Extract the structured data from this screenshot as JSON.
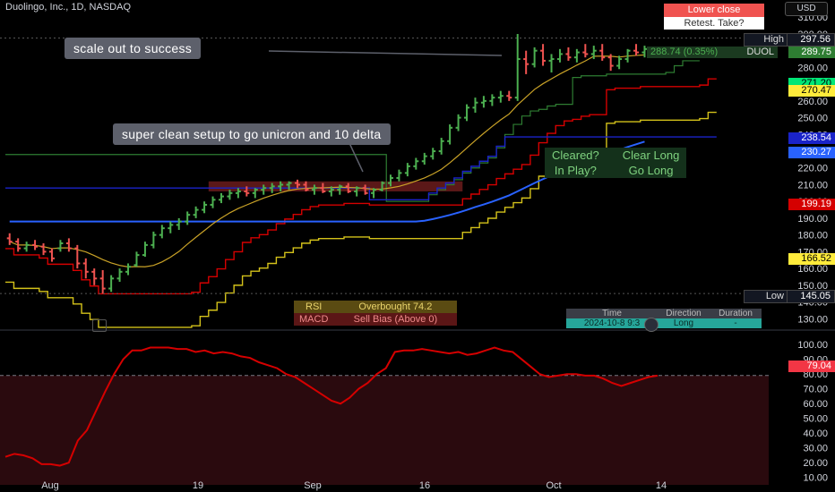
{
  "header": {
    "symbol_title": "Duolingo, Inc., 1D, NASDAQ",
    "currency": "USD"
  },
  "legend_boxes": {
    "lower_close": "Lower close",
    "retest": "Retest. Take?"
  },
  "callouts": {
    "top": "scale out to success",
    "middle": "super clean setup to go unicron and 10 delta"
  },
  "signal_table": {
    "rows": [
      [
        "Cleared?",
        "Clear Long"
      ],
      [
        "In Play?",
        "Go Long"
      ]
    ]
  },
  "indicator_table": {
    "rows": [
      [
        "RSI",
        "Overbought 74.2"
      ],
      [
        "MACD",
        "Sell Bias (Above 0)"
      ]
    ]
  },
  "trade_table": {
    "headers": [
      "Time",
      "Direction",
      "Duration"
    ],
    "row": [
      "2024-10-8 9:3",
      "Long",
      "-"
    ]
  },
  "price_tags": {
    "high_label": "High",
    "high_value": "297.56",
    "symbol": "DUOL",
    "last_value": "289.75",
    "last_change": "288.74 (0.35%)",
    "green_value": "271.20",
    "yellow_value": "270.47",
    "blue_dark_value": "238.54",
    "blue_value": "230.27",
    "red_value": "199.19",
    "yellow2_value": "166.52",
    "low_label": "Low",
    "low_value": "145.05",
    "rsi_value": "79.04"
  },
  "colors": {
    "up": "#4caf50",
    "down": "#f05350",
    "red_band": "#b22222",
    "yellow_band": "#d4c21a",
    "blue_band": "#2962ff",
    "blue_dark": "#1a23c9",
    "green_band": "#2e7d32",
    "tan_ma": "#c9a227"
  },
  "chart_data": [
    {
      "type": "candlestick",
      "title": "Duolingo, Inc., 1D, NASDAQ",
      "x_tick_labels": [
        "Aug",
        "19",
        "Sep",
        "16",
        "Oct",
        "14"
      ],
      "y_ticks": [
        130,
        140,
        150,
        160,
        170,
        180,
        190,
        200,
        210,
        220,
        230,
        240,
        250,
        260,
        270,
        280,
        290,
        300,
        310
      ],
      "ylim": [
        128,
        316
      ],
      "bars": [
        [
          178,
          181,
          174,
          176
        ],
        [
          176,
          178,
          170,
          172
        ],
        [
          172,
          176,
          170,
          174
        ],
        [
          174,
          177,
          171,
          173
        ],
        [
          173,
          175,
          168,
          170
        ],
        [
          170,
          172,
          164,
          166
        ],
        [
          172,
          177,
          170,
          175
        ],
        [
          175,
          178,
          170,
          172
        ],
        [
          172,
          174,
          160,
          163
        ],
        [
          163,
          166,
          154,
          158
        ],
        [
          158,
          160,
          150,
          154
        ],
        [
          154,
          159,
          145,
          148
        ],
        [
          148,
          156,
          146,
          154
        ],
        [
          154,
          160,
          152,
          158
        ],
        [
          158,
          163,
          156,
          161
        ],
        [
          162,
          170,
          161,
          168
        ],
        [
          168,
          176,
          167,
          174
        ],
        [
          174,
          182,
          172,
          180
        ],
        [
          180,
          186,
          178,
          184
        ],
        [
          184,
          188,
          181,
          186
        ],
        [
          186,
          190,
          183,
          188
        ],
        [
          188,
          194,
          186,
          192
        ],
        [
          192,
          197,
          190,
          195
        ],
        [
          195,
          200,
          193,
          198
        ],
        [
          198,
          203,
          196,
          201
        ],
        [
          201,
          205,
          199,
          203
        ],
        [
          203,
          207,
          201,
          205
        ],
        [
          205,
          208,
          202,
          206
        ],
        [
          206,
          209,
          203,
          205
        ],
        [
          205,
          208,
          202,
          207
        ],
        [
          207,
          210,
          204,
          208
        ],
        [
          208,
          211,
          205,
          209
        ],
        [
          209,
          212,
          206,
          210
        ],
        [
          210,
          212,
          207,
          211
        ],
        [
          211,
          213,
          208,
          210
        ],
        [
          210,
          212,
          206,
          207
        ],
        [
          207,
          210,
          204,
          208
        ],
        [
          208,
          211,
          205,
          206
        ],
        [
          206,
          209,
          203,
          207
        ],
        [
          207,
          210,
          204,
          209
        ],
        [
          209,
          211,
          205,
          206
        ],
        [
          206,
          209,
          203,
          208
        ],
        [
          208,
          210,
          204,
          205
        ],
        [
          205,
          208,
          202,
          207
        ],
        [
          207,
          212,
          206,
          211
        ],
        [
          211,
          216,
          209,
          214
        ],
        [
          214,
          219,
          212,
          217
        ],
        [
          217,
          223,
          215,
          221
        ],
        [
          221,
          226,
          219,
          224
        ],
        [
          224,
          229,
          222,
          227
        ],
        [
          227,
          232,
          225,
          230
        ],
        [
          230,
          238,
          228,
          236
        ],
        [
          236,
          246,
          234,
          244
        ],
        [
          244,
          252,
          242,
          250
        ],
        [
          250,
          258,
          248,
          256
        ],
        [
          256,
          262,
          253,
          259
        ],
        [
          259,
          263,
          256,
          260
        ],
        [
          260,
          264,
          257,
          262
        ],
        [
          262,
          266,
          259,
          263
        ],
        [
          263,
          266,
          260,
          262
        ],
        [
          262,
          300,
          260,
          285
        ],
        [
          285,
          290,
          276,
          282
        ],
        [
          282,
          292,
          280,
          290
        ],
        [
          290,
          294,
          281,
          284
        ],
        [
          284,
          288,
          277,
          285
        ],
        [
          285,
          291,
          283,
          288
        ],
        [
          288,
          292,
          284,
          286
        ],
        [
          286,
          291,
          283,
          289
        ],
        [
          289,
          294,
          286,
          288
        ],
        [
          288,
          293,
          285,
          290
        ],
        [
          290,
          294,
          284,
          286
        ],
        [
          286,
          288,
          278,
          281
        ],
        [
          281,
          287,
          279,
          285
        ],
        [
          285,
          291,
          283,
          290
        ],
        [
          290,
          294,
          287,
          289
        ],
        [
          289,
          293,
          286,
          291
        ]
      ]
    },
    {
      "type": "line",
      "title": "RSI",
      "y_ticks": [
        10,
        20,
        30,
        40,
        50,
        60,
        70,
        80,
        90,
        100
      ],
      "ylim": [
        5,
        108
      ],
      "overbought_line": 79.04,
      "values": [
        24,
        26,
        25,
        23,
        19,
        19,
        18,
        20,
        35,
        42,
        55,
        68,
        80,
        90,
        96,
        96,
        98,
        98,
        98,
        97,
        97,
        95,
        96,
        94,
        95,
        94,
        92,
        91,
        88,
        86,
        84,
        80,
        78,
        74,
        70,
        66,
        62,
        60,
        64,
        70,
        74,
        80,
        84,
        95,
        96,
        96,
        97,
        96,
        95,
        94,
        95,
        93,
        94,
        96,
        98,
        96,
        95,
        90,
        85,
        80,
        78,
        79,
        80,
        80,
        79,
        79,
        77,
        74,
        72,
        74,
        76,
        78,
        79
      ]
    }
  ]
}
